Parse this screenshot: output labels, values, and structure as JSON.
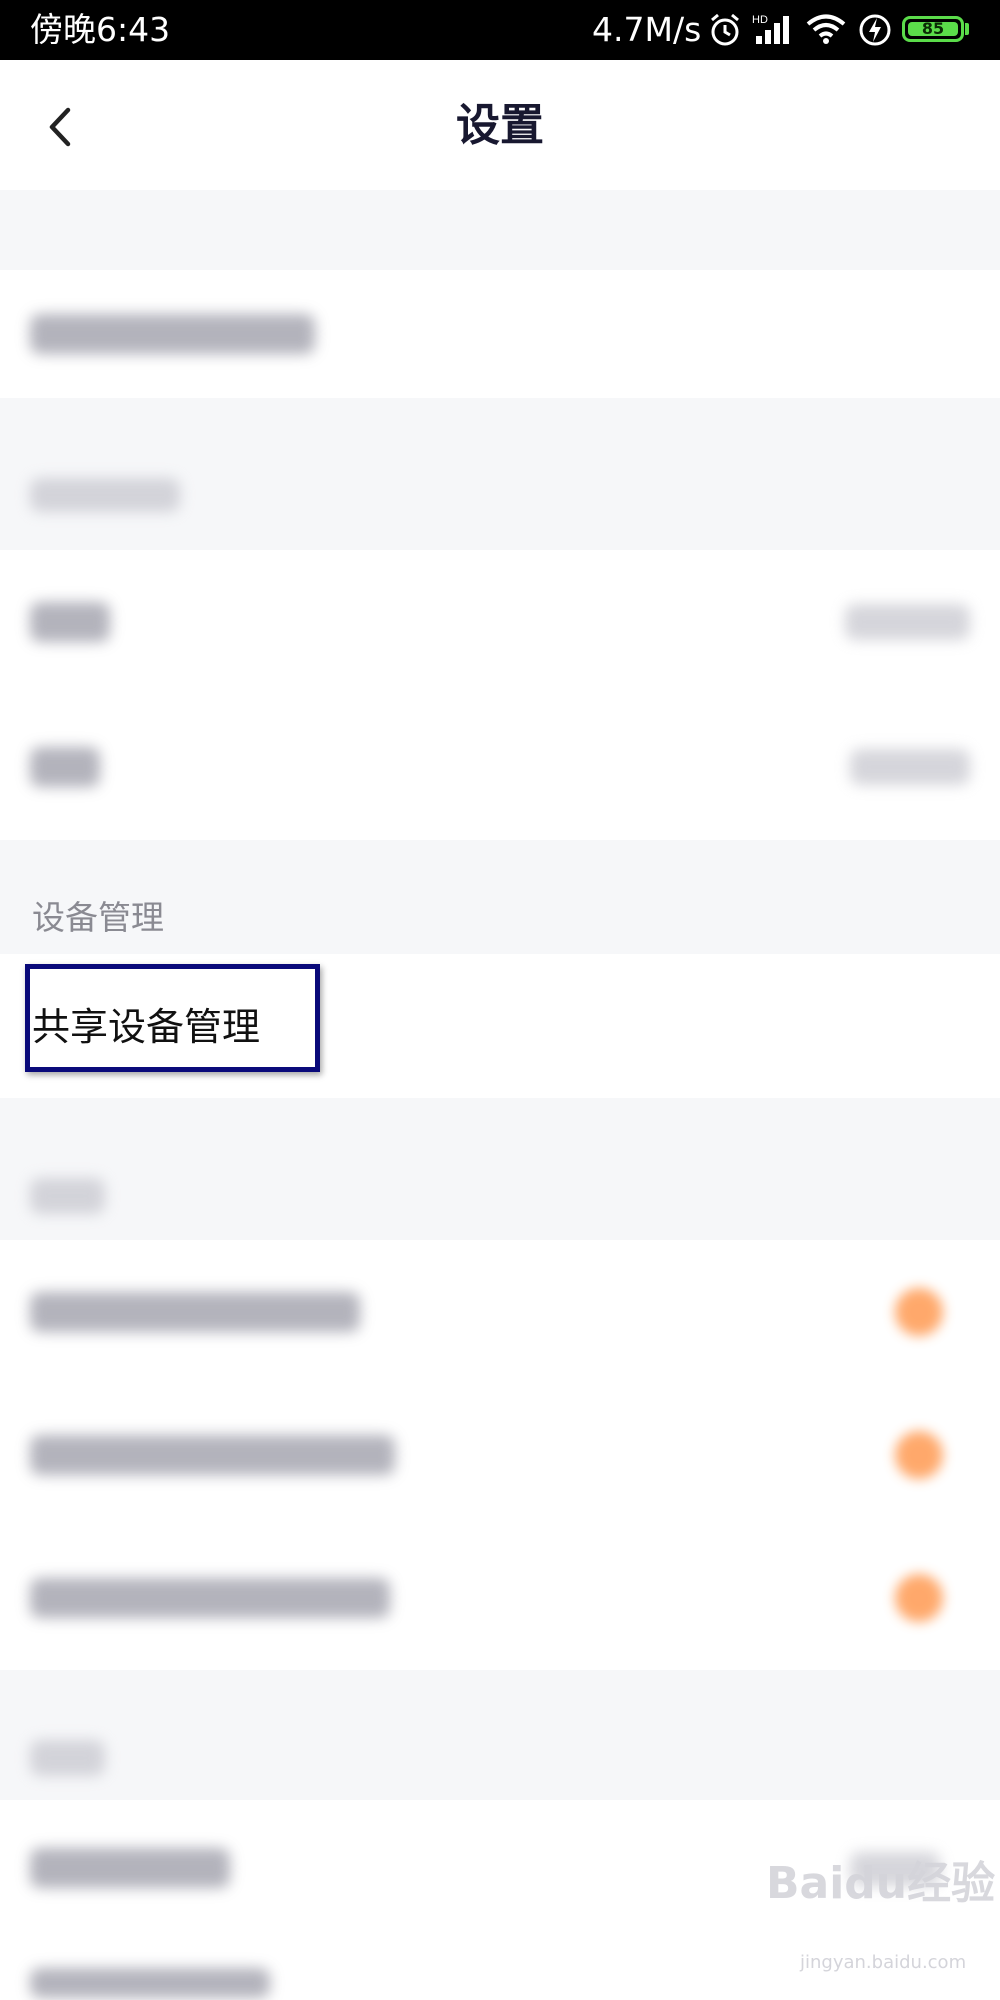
{
  "status_bar": {
    "time": "傍晚6:43",
    "network_speed": "4.7M/s",
    "battery_level": "85",
    "icons": [
      "alarm-icon",
      "signal-icon",
      "wifi-icon",
      "charging-icon",
      "battery-icon"
    ],
    "battery_color": "#5bdc4a"
  },
  "header": {
    "title": "设置",
    "back_icon": "chevron-left-icon"
  },
  "sections": {
    "device_management": {
      "header": "设备管理",
      "items": [
        {
          "label": "共享设备管理"
        }
      ]
    }
  },
  "highlight": {
    "target": "共享设备管理",
    "color": "#0a0a7a"
  },
  "watermark": {
    "text": "Baidu经验",
    "url": "jingyan.baidu.com"
  },
  "colors": {
    "toggle_accent": "#ff9a52",
    "background": "#f6f7f9"
  }
}
